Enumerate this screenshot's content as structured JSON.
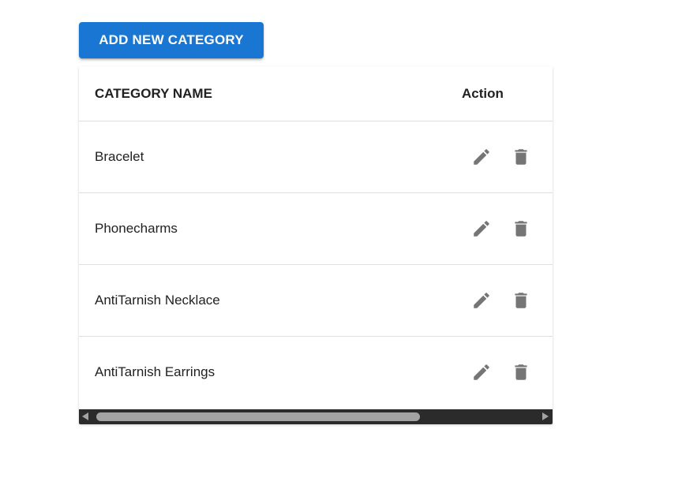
{
  "toolbar": {
    "add_button_label": "ADD NEW CATEGORY",
    "accent_color": "#1976d2"
  },
  "table": {
    "columns": {
      "name": "CATEGORY NAME",
      "action": "Action"
    },
    "rows": [
      {
        "name": "Bracelet",
        "actions": [
          "edit-icon",
          "delete-icon"
        ]
      },
      {
        "name": "Phonecharms",
        "actions": [
          "edit-icon",
          "delete-icon"
        ]
      },
      {
        "name": "AntiTarnish Necklace",
        "actions": [
          "edit-icon",
          "delete-icon"
        ]
      },
      {
        "name": "AntiTarnish Earrings",
        "actions": [
          "edit-icon",
          "delete-icon"
        ]
      }
    ],
    "icon_color": "#757575"
  },
  "scrollbar": {
    "orientation": "horizontal",
    "track_color": "#2b2b2b",
    "thumb_color": "#a3a3a3"
  }
}
